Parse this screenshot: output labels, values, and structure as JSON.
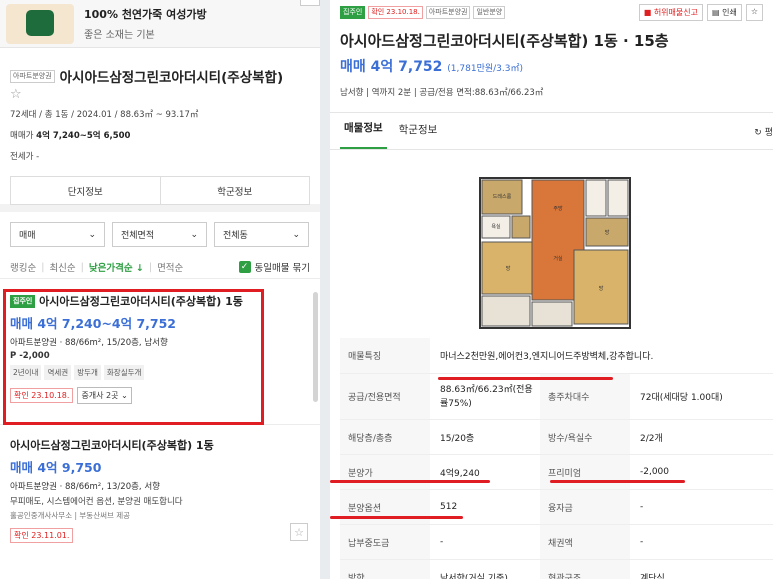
{
  "ad": {
    "title": "100% 천연가죽 여성가방",
    "subtitle": "좋은 소재는 기본"
  },
  "complex": {
    "tag": "아파트분양권",
    "name": "아시아드삼정그린코아더시티(주상복합)",
    "meta": "72세대 / 총 1동 / 2024.01 / 88.63㎡ ~ 93.17㎡",
    "sale_label": "매매가",
    "sale_value": "4억 7,240~5억 6,500",
    "jeonse_label": "전세가",
    "jeonse_value": "-",
    "btn_info": "단지정보",
    "btn_school": "학군정보"
  },
  "filters": {
    "deal": "매매",
    "area": "전체면적",
    "dong": "전체동"
  },
  "sort": {
    "items": [
      "랭킹순",
      "최신순",
      "낮은가격순",
      "면적순"
    ],
    "active_arrow": "↓",
    "same_label": "동일매물 묶기"
  },
  "list": [
    {
      "tag": "집주인",
      "title": "아시아드삼정그린코아더시티(주상복합) 1동",
      "price": "매매 4억 7,240~4억 7,752",
      "spec": "아파트분양권 · 88/66m², 15/20층, 남서향",
      "extra": "P -2,000",
      "chips": [
        "2년이내",
        "역세권",
        "방두개",
        "화장실두개"
      ],
      "confirm": "확인 23.10.18.",
      "agent": "중개사 2곳"
    },
    {
      "title": "아시아드삼정그린코아더시티(주상복합) 1동",
      "price": "매매 4억 9,750",
      "spec": "아파트분양권 · 88/66m², 13/20층, 서향",
      "desc": "무피매도, 시스템에어컨 옵션, 분양권 매도합니다",
      "office": "홀공인중개사사무소 | 부동산써브 제공",
      "confirm": "확인 23.11.01."
    }
  ],
  "detail": {
    "tags": [
      "집주인",
      "확인 23.10.18.",
      "아파트분양권",
      "일반분양"
    ],
    "report": "허위매물신고",
    "print": "인쇄",
    "title": "아시아드삼정그린코아더시티(주상복합) 1동 · 15층",
    "price": "매매 4억 7,752",
    "price_sub": "(1,781만원/3.3㎡)",
    "info": "남서향 | 역까지 2분 | 공급/전용 면적:88.63㎡/66.23㎡",
    "tab1": "매물정보",
    "tab2": "학군정보",
    "refresh": "평"
  },
  "table": {
    "feature_label": "매물특징",
    "feature_value": "마너스2천만원,에어컨3,엔지니어드주방벽체,강추합니다.",
    "r1": [
      "공급/전용면적",
      "88.63㎡/66.23㎡(전용률75%)",
      "총주차대수",
      "72대(세대당 1.00대)"
    ],
    "r2": [
      "해당층/총층",
      "15/20층",
      "방수/욕실수",
      "2/2개"
    ],
    "r3": [
      "분양가",
      "4억9,240",
      "프리미엄",
      "-2,000"
    ],
    "r4": [
      "분양옵션",
      "512",
      "융자금",
      "-"
    ],
    "r5": [
      "납부중도금",
      "-",
      "채권액",
      "-"
    ],
    "r6": [
      "방향",
      "남서향(거실 기준)",
      "현관구조",
      "계단식"
    ]
  },
  "plan_labels": {
    "drs": "드레스룸",
    "rm1": "방",
    "rm2": "방",
    "rm3": "방",
    "kit": "주방",
    "living": "거실",
    "bath": "욕실"
  },
  "colors": {
    "green": "#2ea043",
    "blue": "#3b6fd6",
    "red": "#e11d24"
  }
}
